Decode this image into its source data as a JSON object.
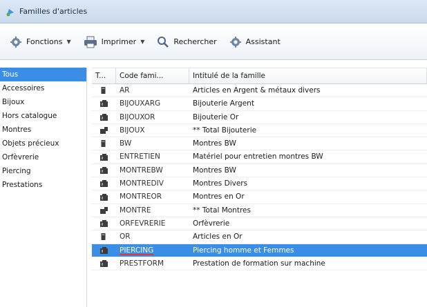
{
  "window": {
    "title": "Familles d'articles"
  },
  "toolbar": {
    "fonctions_label": "Fonctions",
    "imprimer_label": "Imprimer",
    "rechercher_label": "Rechercher",
    "assistant_label": "Assistant"
  },
  "sidebar": {
    "items": [
      {
        "label": "Tous"
      },
      {
        "label": "Accessoires"
      },
      {
        "label": "Bijoux"
      },
      {
        "label": "Hors catalogue"
      },
      {
        "label": "Montres"
      },
      {
        "label": "Objets précieux"
      },
      {
        "label": "Orfèvrerie"
      },
      {
        "label": "Piercing"
      },
      {
        "label": "Prestations"
      }
    ],
    "selected_index": 0
  },
  "grid": {
    "columns": [
      "T...",
      "Code fami...",
      "Intitulé de la famille"
    ],
    "rows": [
      {
        "type_icon": "detail-family-icon",
        "code": "AR",
        "label": "Articles en Argent & métaux divers"
      },
      {
        "type_icon": "central-family-icon",
        "code": "BIJOUXARG",
        "label": "Bijouterie Argent"
      },
      {
        "type_icon": "central-family-icon",
        "code": "BIJOUXOR",
        "label": "Bijouterie Or"
      },
      {
        "type_icon": "total-family-icon",
        "code": "BIJOUX",
        "label": "** Total Bijouterie"
      },
      {
        "type_icon": "detail-family-icon",
        "code": "BW",
        "label": "Montres BW"
      },
      {
        "type_icon": "central-family-icon",
        "code": "ENTRETIEN",
        "label": "Matériel pour entretien montres BW"
      },
      {
        "type_icon": "central-family-icon",
        "code": "MONTREBW",
        "label": "Montres BW"
      },
      {
        "type_icon": "central-family-icon",
        "code": "MONTREDIV",
        "label": "Montres Divers"
      },
      {
        "type_icon": "central-family-icon",
        "code": "MONTREOR",
        "label": "Montres en Or"
      },
      {
        "type_icon": "total-family-icon",
        "code": "MONTRE",
        "label": "** Total Montres"
      },
      {
        "type_icon": "central-family-icon",
        "code": "ORFEVRERIE",
        "label": "Orfèvrerie"
      },
      {
        "type_icon": "detail-family-icon",
        "code": "OR",
        "label": "Articles en Or"
      },
      {
        "type_icon": "central-family-icon",
        "code": "PIERCING",
        "label": "Piercing homme et Femmes"
      },
      {
        "type_icon": "central-family-icon",
        "code": "PRESTFORM",
        "label": "Prestation de formation sur machine"
      }
    ],
    "selected_index": 12
  },
  "colors": {
    "selection": "#3a8ee6",
    "titlebar": "#c9d9ec",
    "error_underline": "#e53935"
  }
}
